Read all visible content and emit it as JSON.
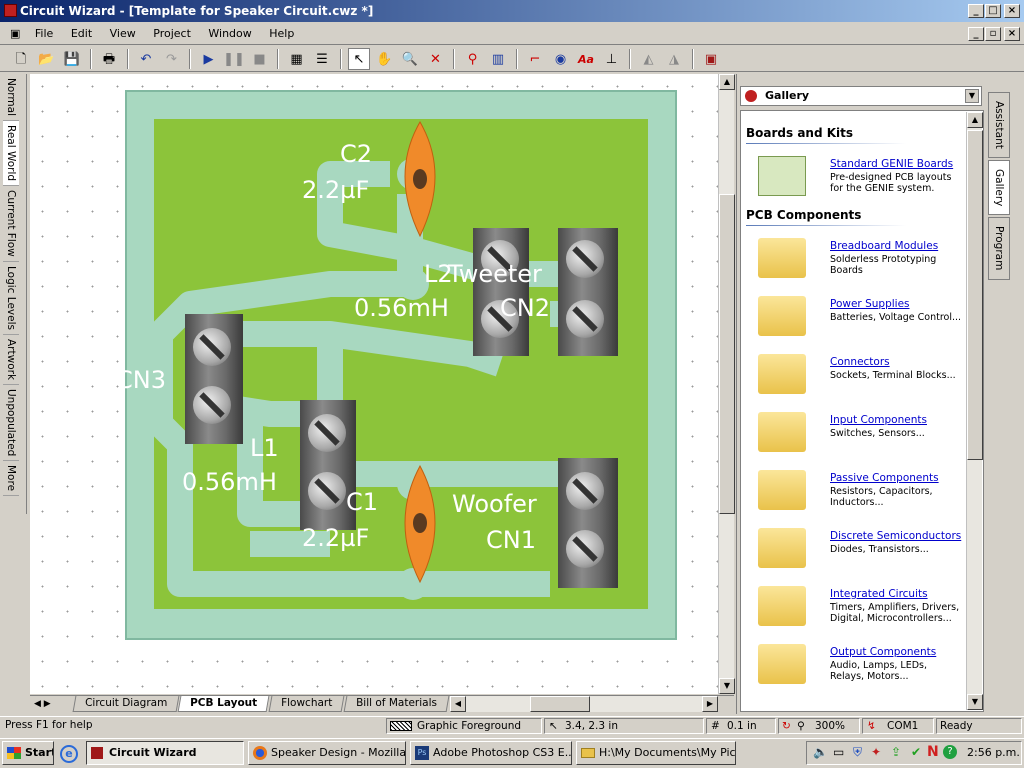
{
  "window": {
    "title": "Circuit Wizard - [Template for Speaker Circuit.cwz *]"
  },
  "menu": [
    "File",
    "Edit",
    "View",
    "Project",
    "Window",
    "Help"
  ],
  "left_tabs": [
    "Normal",
    "Real World",
    "Current Flow",
    "Logic Levels",
    "Artwork",
    "Unpopulated",
    "More"
  ],
  "pcb_labels": {
    "c2_name": "C2",
    "c2_value": "2.2µF",
    "l2_name": "L2",
    "tweeter": "Tweeter",
    "l2_value": "0.56mH",
    "cn2": "CN2",
    "cn3": "CN3",
    "l1_name": "L1",
    "l1_value": "0.56mH",
    "c1_name": "C1",
    "c1_value": "2.2µF",
    "woofer": "Woofer",
    "cn1": "CN1"
  },
  "bottom_tabs": [
    "Circuit Diagram",
    "PCB Layout",
    "Flowchart",
    "Bill of Materials"
  ],
  "gallery": {
    "selector": "Gallery",
    "sections": [
      {
        "title": "Boards and Kits",
        "items": [
          {
            "name": "Standard GENIE Boards",
            "desc": "Pre-designed PCB layouts for the GENIE system."
          }
        ]
      },
      {
        "title": "PCB Components",
        "items": [
          {
            "name": "Breadboard Modules",
            "desc": "Solderless Prototyping Boards"
          },
          {
            "name": "Power Supplies",
            "desc": "Batteries, Voltage Control..."
          },
          {
            "name": "Connectors",
            "desc": "Sockets, Terminal Blocks..."
          },
          {
            "name": "Input Components",
            "desc": "Switches, Sensors..."
          },
          {
            "name": "Passive Components",
            "desc": "Resistors, Capacitors, Inductors..."
          },
          {
            "name": "Discrete Semiconductors",
            "desc": "Diodes, Transistors..."
          },
          {
            "name": "Integrated Circuits",
            "desc": "Timers, Amplifiers, Drivers, Digital, Microcontrollers..."
          },
          {
            "name": "Output Components",
            "desc": "Audio, Lamps, LEDs, Relays, Motors..."
          }
        ]
      }
    ]
  },
  "right_tabs": [
    "Assistant",
    "Gallery",
    "Program"
  ],
  "status": {
    "help": "Press F1 for help",
    "layer": "Graphic Foreground",
    "coords": "3.4, 2.3 in",
    "grid": "0.1 in",
    "zoom": "300%",
    "port": "COM1",
    "state": "Ready"
  },
  "taskbar": {
    "start": "Start",
    "tasks": [
      "Circuit Wizard",
      "Speaker Design - Mozilla ...",
      "Adobe Photoshop CS3 E...",
      "H:\\My Documents\\My Pic..."
    ],
    "clock": "2:56 p.m."
  },
  "colors": {
    "board": "#8cc43a",
    "border": "#a8d8c0",
    "track": "#a8d8c0",
    "capacitor": "#f08a2a"
  }
}
